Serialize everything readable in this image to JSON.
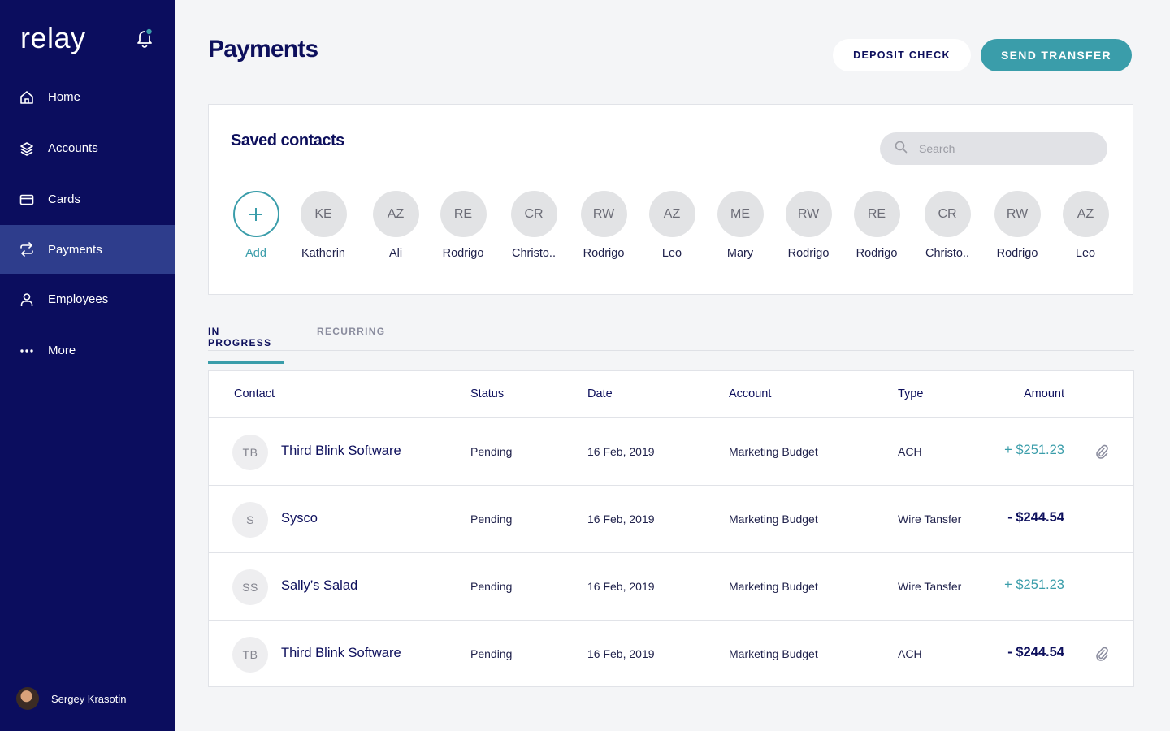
{
  "sidebar": {
    "logo": "relay",
    "nav": [
      {
        "label": "Home",
        "icon": "home-icon"
      },
      {
        "label": "Accounts",
        "icon": "layers-icon"
      },
      {
        "label": "Cards",
        "icon": "card-icon"
      },
      {
        "label": "Payments",
        "icon": "transfer-icon",
        "active": true
      },
      {
        "label": "Employees",
        "icon": "user-icon"
      },
      {
        "label": "More",
        "icon": "more-icon"
      }
    ],
    "user": {
      "name": "Sergey Krasotin"
    }
  },
  "header": {
    "title": "Payments",
    "deposit_label": "DEPOSIT CHECK",
    "send_label": "SEND TRANSFER"
  },
  "saved_contacts": {
    "title": "Saved contacts",
    "search_placeholder": "Search",
    "add_label": "Add",
    "contacts": [
      {
        "initials": "KE",
        "name": "Katherin"
      },
      {
        "initials": "AZ",
        "name": "Ali"
      },
      {
        "initials": "RE",
        "name": "Rodrigo"
      },
      {
        "initials": "CR",
        "name": "Christo.."
      },
      {
        "initials": "RW",
        "name": "Rodrigo"
      },
      {
        "initials": "AZ",
        "name": "Leo"
      },
      {
        "initials": "ME",
        "name": "Mary"
      },
      {
        "initials": "RW",
        "name": "Rodrigo"
      },
      {
        "initials": "RE",
        "name": "Rodrigo"
      },
      {
        "initials": "CR",
        "name": "Christo.."
      },
      {
        "initials": "RW",
        "name": "Rodrigo"
      },
      {
        "initials": "AZ",
        "name": "Leo"
      }
    ]
  },
  "tabs": {
    "in_progress": "IN PROGRESS",
    "recurring": "RECURRING"
  },
  "table": {
    "columns": {
      "contact": "Contact",
      "status": "Status",
      "date": "Date",
      "account": "Account",
      "type": "Type",
      "amount": "Amount"
    },
    "rows": [
      {
        "initials": "TB",
        "contact": "Third Blink Software",
        "status": "Pending",
        "date": "16 Feb, 2019",
        "account": "Marketing Budget",
        "type": "ACH",
        "amount": "+ $251.23",
        "positive": true,
        "attachment": true
      },
      {
        "initials": "S",
        "contact": "Sysco",
        "status": "Pending",
        "date": "16 Feb, 2019",
        "account": "Marketing Budget",
        "type": "Wire Tansfer",
        "amount": "- $244.54",
        "positive": false,
        "attachment": false
      },
      {
        "initials": "SS",
        "contact": "Sally’s Salad",
        "status": "Pending",
        "date": "16 Feb, 2019",
        "account": "Marketing Budget",
        "type": "Wire Tansfer",
        "amount": "+ $251.23",
        "positive": true,
        "attachment": false
      },
      {
        "initials": "TB",
        "contact": "Third Blink Software",
        "status": "Pending",
        "date": "16 Feb, 2019",
        "account": "Marketing Budget",
        "type": "ACH",
        "amount": "- $244.54",
        "positive": false,
        "attachment": true
      }
    ]
  },
  "colors": {
    "sidebar_bg": "#0b0d5e",
    "sidebar_active": "#2e3d8c",
    "accent": "#3a9daa",
    "text_primary": "#0d0f5c"
  }
}
